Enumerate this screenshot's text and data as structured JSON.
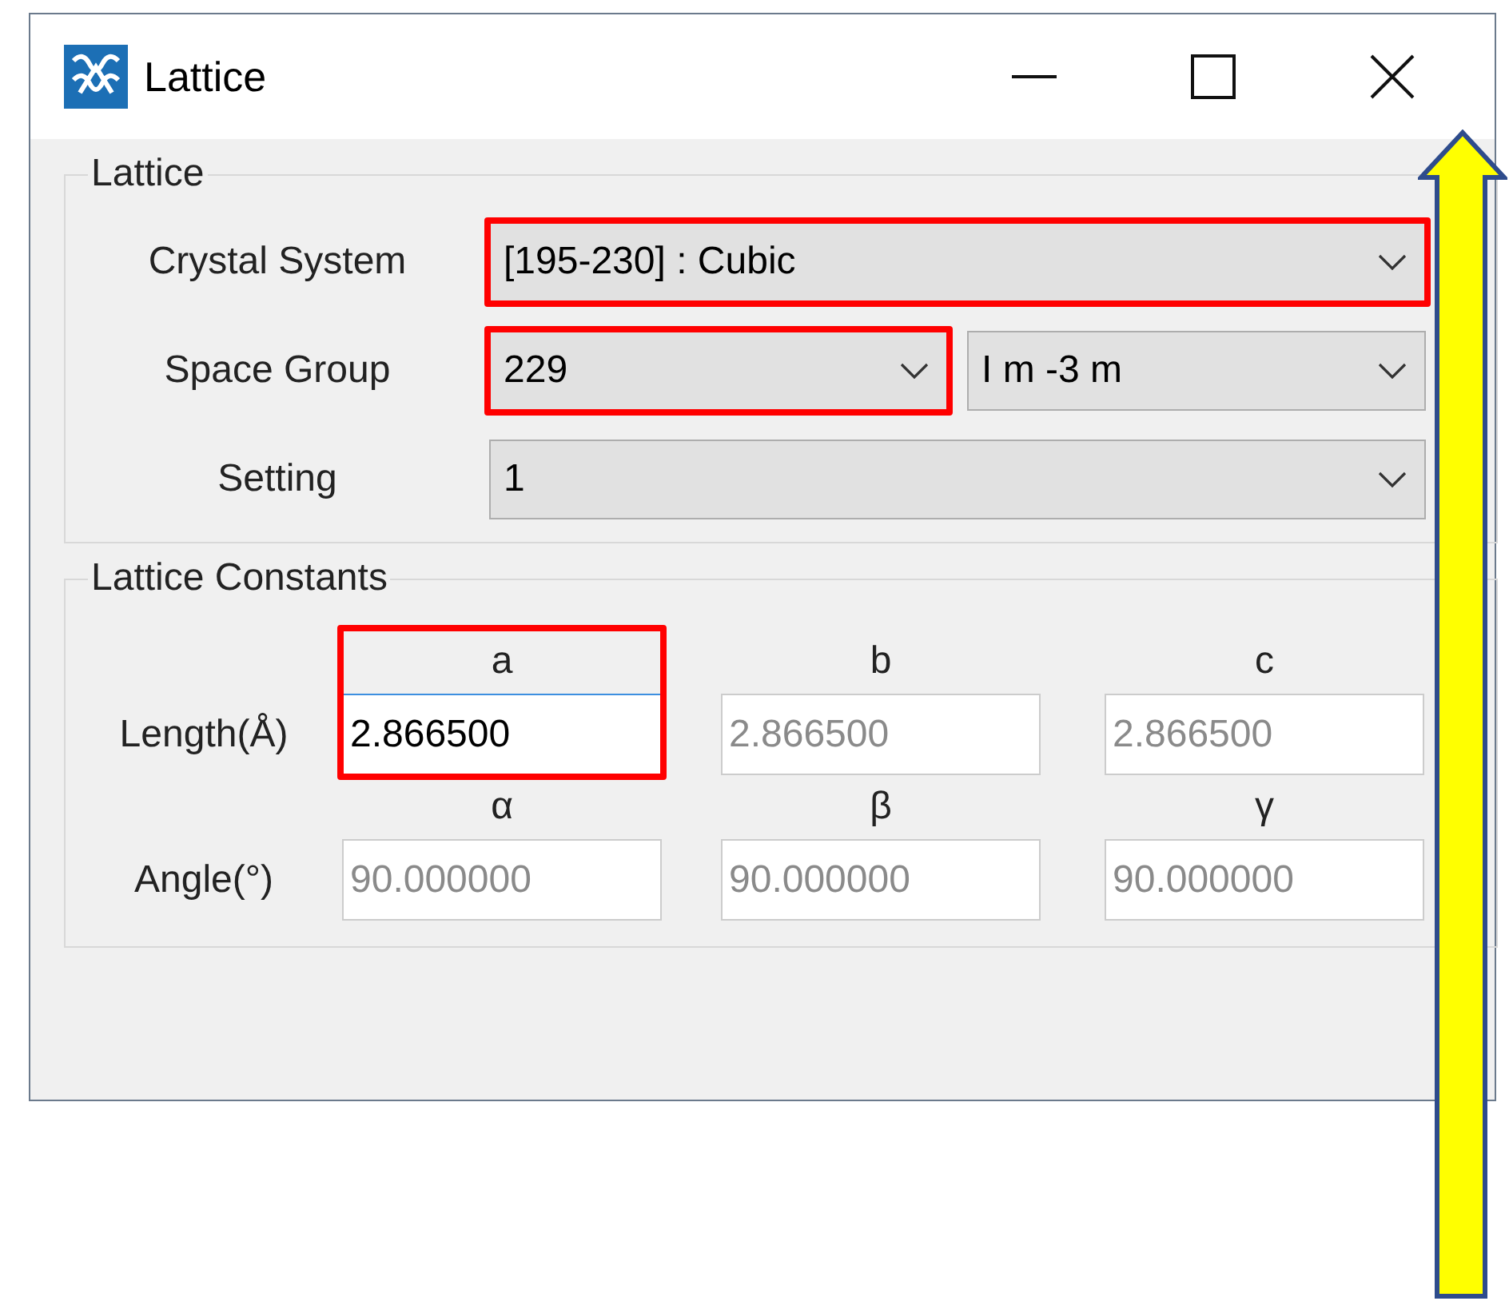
{
  "window": {
    "title": "Lattice"
  },
  "lattice_group": {
    "title": "Lattice",
    "rows": [
      {
        "label": "Crystal System",
        "combos": [
          {
            "value": "[195-230] : Cubic",
            "highlighted": true
          }
        ]
      },
      {
        "label": "Space Group",
        "combos": [
          {
            "value": "229",
            "highlighted": true
          },
          {
            "value": "I m -3 m",
            "highlighted": false
          }
        ]
      },
      {
        "label": "Setting",
        "combos": [
          {
            "value": "1",
            "highlighted": false
          }
        ]
      }
    ]
  },
  "constants_group": {
    "title": "Lattice Constants",
    "rows": [
      {
        "label": "Length(Å)",
        "cells": [
          {
            "header": "a",
            "value": "2.866500",
            "disabled": false,
            "highlighted": true
          },
          {
            "header": "b",
            "value": "2.866500",
            "disabled": true,
            "highlighted": false
          },
          {
            "header": "c",
            "value": "2.866500",
            "disabled": true,
            "highlighted": false
          }
        ]
      },
      {
        "label": "Angle(°)",
        "cells": [
          {
            "header": "α",
            "value": "90.000000",
            "disabled": true,
            "highlighted": false
          },
          {
            "header": "β",
            "value": "90.000000",
            "disabled": true,
            "highlighted": false
          },
          {
            "header": "γ",
            "value": "90.000000",
            "disabled": true,
            "highlighted": false
          }
        ]
      }
    ]
  }
}
